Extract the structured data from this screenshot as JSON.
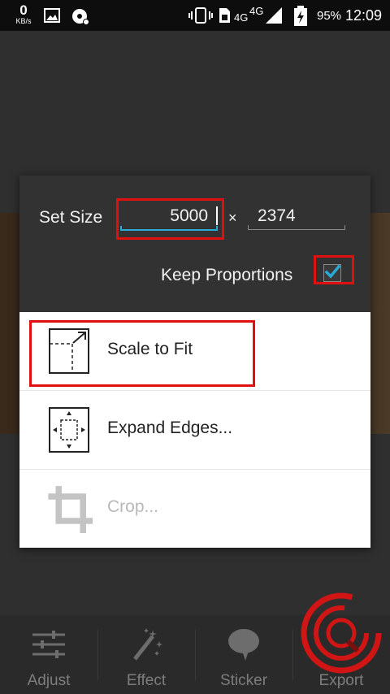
{
  "status_bar": {
    "speed_value": "0",
    "speed_unit": "KB/s",
    "network_labels": [
      "4G",
      "4G"
    ],
    "battery_percent": "95%",
    "time": "12:09",
    "icons": [
      "image-icon",
      "disc-icon",
      "vibrate-icon",
      "sim-icon",
      "signal-icon",
      "battery-charging-icon"
    ]
  },
  "dialog": {
    "set_size_label": "Set Size",
    "width_value": "5000",
    "separator": "×",
    "height_value": "2374",
    "keep_proportions_label": "Keep Proportions",
    "keep_proportions_checked": true,
    "menu": [
      {
        "label": "Scale to Fit",
        "icon": "scale-to-fit-icon",
        "enabled": true
      },
      {
        "label": "Expand Edges...",
        "icon": "expand-edges-icon",
        "enabled": true
      },
      {
        "label": "Crop...",
        "icon": "crop-icon",
        "enabled": false
      }
    ]
  },
  "toolbar": {
    "items": [
      {
        "label": "Adjust",
        "icon": "sliders-icon"
      },
      {
        "label": "Effect",
        "icon": "magic-wand-icon"
      },
      {
        "label": "Sticker",
        "icon": "speech-bubble-icon"
      },
      {
        "label": "Export",
        "icon": "export-icon"
      }
    ]
  },
  "colors": {
    "accent": "#29a9d6",
    "highlight_border": "#e01010",
    "dialog_bg": "#323232",
    "menu_bg": "#ffffff"
  }
}
